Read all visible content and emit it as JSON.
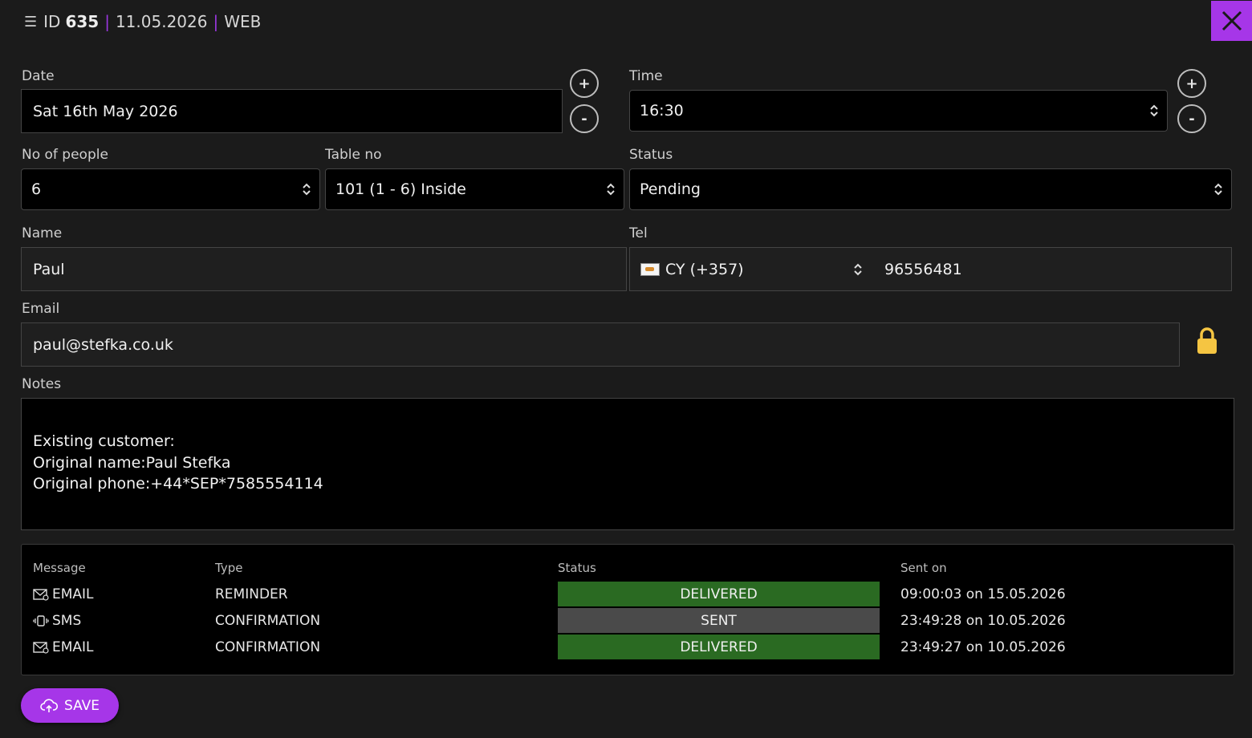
{
  "header": {
    "id_prefix": "ID",
    "id_number": "635",
    "separator": "|",
    "date": "11.05.2026",
    "source": "WEB"
  },
  "colors": {
    "accent": "#a636e8",
    "delivered": "#2a6a22",
    "sent": "#4a4a4a",
    "lock": "#f5c542"
  },
  "form": {
    "date_label": "Date",
    "date_value": "Sat 16th May 2026",
    "time_label": "Time",
    "time_value": "16:30",
    "people_label": "No of people",
    "people_value": "6",
    "table_label": "Table no",
    "table_value": "101 (1 - 6) Inside",
    "status_label": "Status",
    "status_value": "Pending",
    "name_label": "Name",
    "name_value": "Paul",
    "tel_label": "Tel",
    "tel_country": "CY (+357)",
    "tel_number": "96556481",
    "email_label": "Email",
    "email_value": "paul@stefka.co.uk",
    "notes_label": "Notes",
    "notes_value": "Existing customer:\nOriginal name:Paul Stefka\nOriginal phone:+44*SEP*7585554114",
    "plus_symbol": "+",
    "minus_symbol": "-"
  },
  "messages": {
    "headers": {
      "message": "Message",
      "type": "Type",
      "status": "Status",
      "sent_on": "Sent on"
    },
    "rows": [
      {
        "channel": "EMAIL",
        "icon": "envelope-icon",
        "type": "REMINDER",
        "status": "DELIVERED",
        "sent_on": "09:00:03 on 15.05.2026"
      },
      {
        "channel": "SMS",
        "icon": "vibrating-phone-icon",
        "type": "CONFIRMATION",
        "status": "SENT",
        "sent_on": "23:49:28 on 10.05.2026"
      },
      {
        "channel": "EMAIL",
        "icon": "envelope-icon",
        "type": "CONFIRMATION",
        "status": "DELIVERED",
        "sent_on": "23:49:27 on 10.05.2026"
      }
    ]
  },
  "save_label": "SAVE"
}
